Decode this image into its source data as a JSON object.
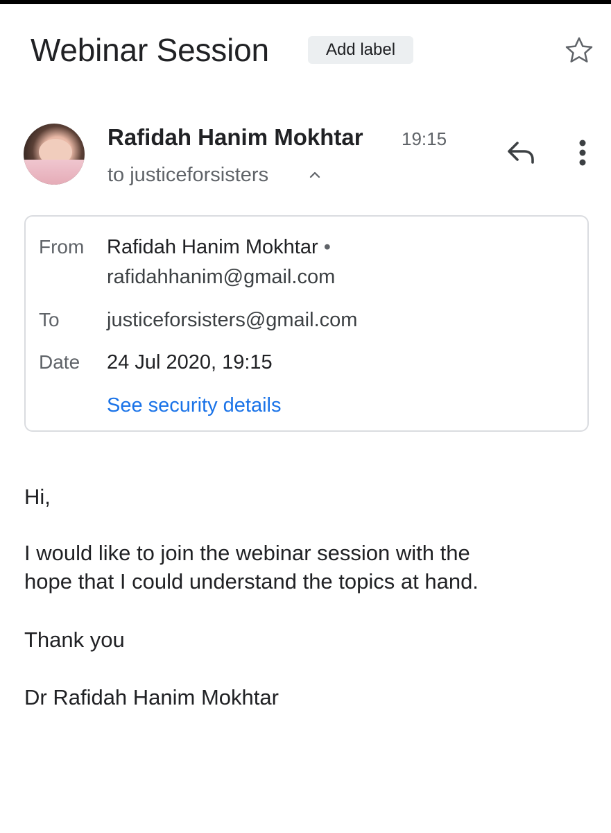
{
  "header": {
    "subject": "Webinar Session",
    "add_label": "Add label",
    "star_icon": "star-outline-icon"
  },
  "message": {
    "sender_name": "Rafidah Hanim Mokhtar",
    "time": "19:15",
    "recipient_summary": "to justiceforsisters",
    "icons": [
      "reply-icon",
      "more-vert-icon",
      "chevron-up-icon"
    ]
  },
  "details": {
    "from_label": "From",
    "from_name": "Rafidah Hanim Mokhtar",
    "from_separator": "•",
    "from_email": "rafidahhanim@gmail.com",
    "to_label": "To",
    "to_email": "justiceforsisters@gmail.com",
    "date_label": "Date",
    "date_value": "24 Jul 2020, 19:15",
    "security_link": "See security details"
  },
  "body": {
    "greeting": "Hi,",
    "line1": "I would like to join the webinar session with the",
    "line2": "hope that I could understand the topics at hand.",
    "closing": "Thank you",
    "signature": "Dr Rafidah Hanim Mokhtar"
  },
  "colors": {
    "link": "#1a73e8",
    "secondary_text": "#5f6368",
    "chip_bg": "#eceff1",
    "border": "#dadce0"
  }
}
